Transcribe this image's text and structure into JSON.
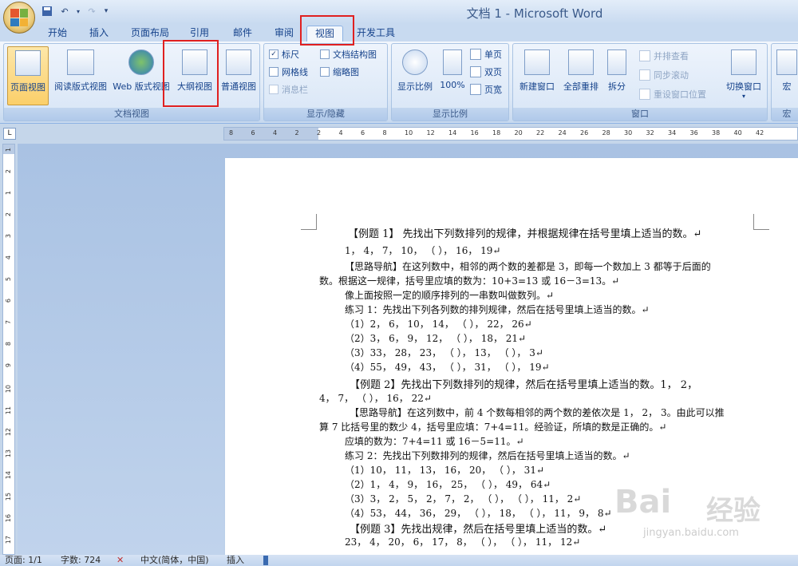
{
  "window": {
    "title": "文档 1 - Microsoft Word"
  },
  "tabs": [
    {
      "label": "开始"
    },
    {
      "label": "插入"
    },
    {
      "label": "页面布局"
    },
    {
      "label": "引用"
    },
    {
      "label": "邮件"
    },
    {
      "label": "审阅"
    },
    {
      "label": "视图"
    },
    {
      "label": "开发工具"
    }
  ],
  "ribbon": {
    "doc_views": {
      "label": "文档视图",
      "print_layout": "页面视图",
      "full_screen_reading": "阅读版式视图",
      "web_layout": "Web 版式视图",
      "outline": "大纲视图",
      "draft": "普通视图"
    },
    "show_hide": {
      "label": "显示/隐藏",
      "ruler": "标尺",
      "gridlines": "网格线",
      "message_bar": "消息栏",
      "document_map": "文档结构图",
      "thumbnails": "缩略图"
    },
    "zoom": {
      "label": "显示比例",
      "zoom": "显示比例",
      "percent": "100%",
      "one_page": "单页",
      "two_pages": "双页",
      "page_width": "页宽"
    },
    "window": {
      "label": "窗口",
      "new_window": "新建窗口",
      "arrange_all": "全部重排",
      "split": "拆分",
      "side_by_side": "并排查看",
      "sync_scroll": "同步滚动",
      "reset_position": "重设窗口位置",
      "switch_windows": "切换窗口"
    },
    "macros": {
      "label": "宏",
      "button": "宏"
    }
  },
  "ruler": {
    "h_ticks": [
      "8",
      "6",
      "4",
      "2",
      "2",
      "4",
      "6",
      "8",
      "10",
      "12",
      "14",
      "16",
      "18",
      "20",
      "22",
      "24",
      "26",
      "28",
      "30",
      "32",
      "34",
      "36",
      "38",
      "40",
      "42"
    ],
    "v_ticks": [
      "1",
      "2",
      "1",
      "2",
      "3",
      "4",
      "5",
      "6",
      "7",
      "8",
      "9",
      "10",
      "11",
      "12",
      "13",
      "14",
      "15",
      "16",
      "17",
      "18"
    ]
  },
  "document": {
    "lines": [
      "【例题 1】 先找出下列数排列的规律，并根据规律在括号里填上适当的数。↵",
      "1， 4， 7， 10， （      ）， 16， 19↵",
      "【思路导航】在这列数中，相邻的两个数的差都是 3，即每一个数加上 3 都等于后面的",
      "数。根据这一规律，括号里应填的数为：10+3=13 或 16－3=13。↵",
      "像上面按照一定的顺序排列的一串数叫做数列。↵",
      "练习 1：先找出下列各列数的排列规律，然后在括号里填上适当的数。↵",
      "（1）2， 6， 10， 14， （      ）， 22， 26↵",
      "（2）3， 6， 9， 12， （      ）， 18， 21↵",
      "（3）33， 28， 23， （      ）， 13， （      ）， 3↵",
      "（4）55， 49， 43， （      ）， 31， （      ）， 19↵",
      "【例题 2】先找出下列数排列的规律，然后在括号里填上适当的数。1， 2，",
      "4， 7， （      ）， 16， 22↵",
      "【思路导航】在这列数中，前 4 个数每相邻的两个数的差依次是 1， 2， 3。由此可以推",
      "算 7 比括号里的数少 4，括号里应填：7+4=11。经验证，所填的数是正确的。↵",
      "应填的数为：7+4=11 或 16－5=11。↵",
      "练习 2：先找出下列数排列的规律，然后在括号里填上适当的数。↵",
      "（1）10， 11， 13， 16， 20， （      ）， 31↵",
      "（2）1， 4， 9， 16， 25， （      ）， 49， 64↵",
      "（3）3， 2， 5， 2， 7， 2， （      ）， （      ）， 11， 2↵",
      "（4）53， 44， 36， 29， （      ）， 18， （      ）， 11， 9， 8↵",
      "【例题 3】先找出规律，然后在括号里填上适当的数。↵",
      "23， 4， 20， 6， 17， 8， （      ）， （      ）， 11， 12↵"
    ]
  },
  "statusbar": {
    "page": "页面: 1/1",
    "words": "字数: 724",
    "language": "中文(简体，中国)",
    "mode": "插入"
  },
  "watermark": {
    "brand": "Bai",
    "brand2": "经验",
    "url": "jingyan.baidu.com"
  }
}
